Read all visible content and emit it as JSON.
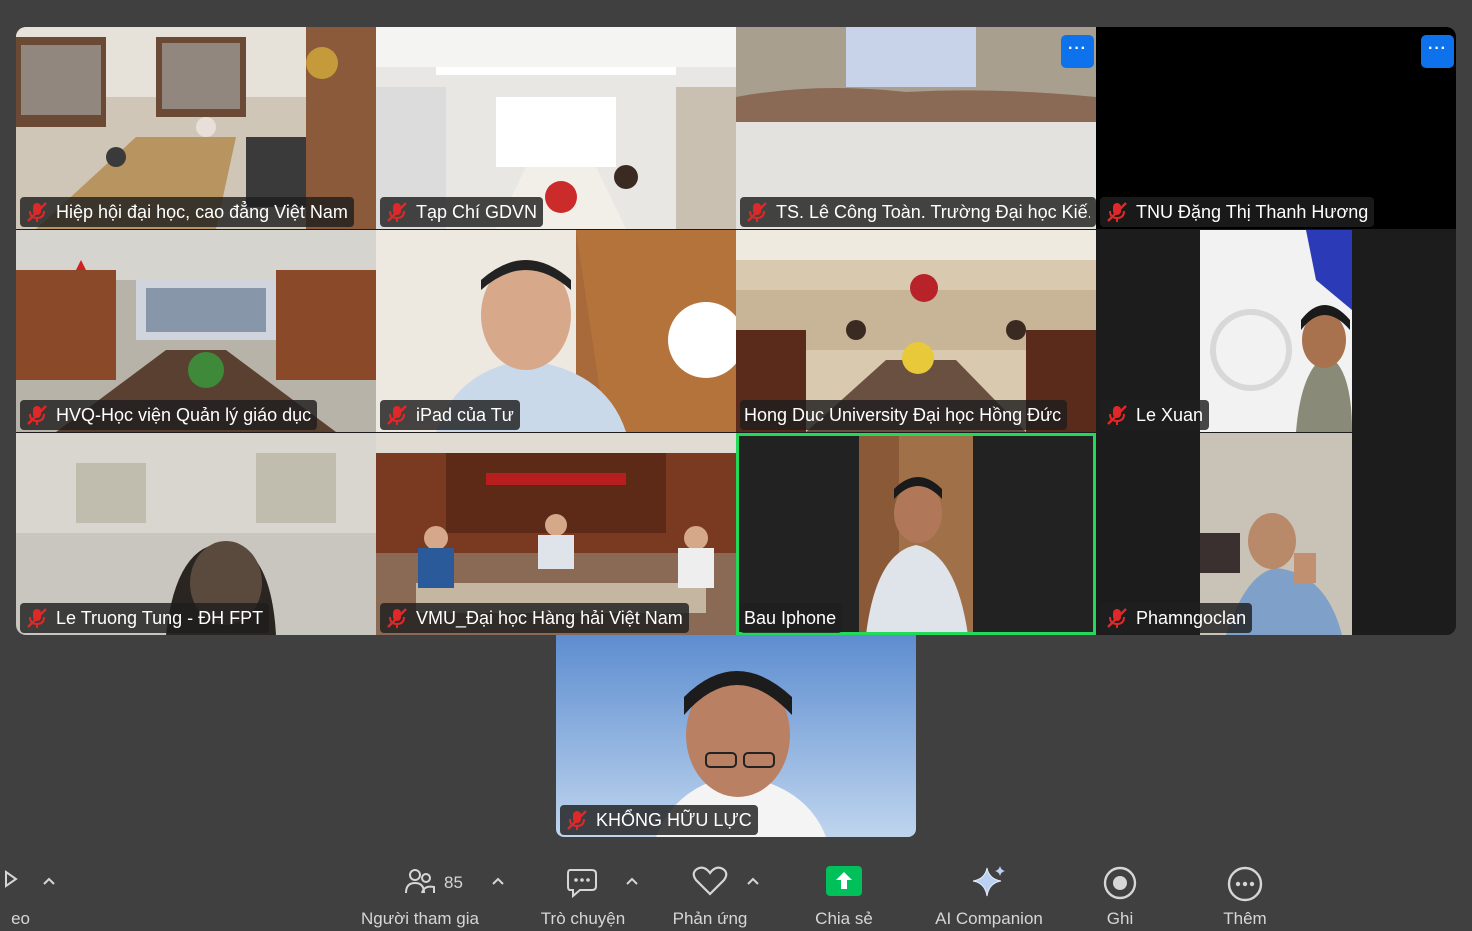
{
  "tiles": [
    {
      "name": "Hiệp hội đại học, cao đẳng Việt Nam",
      "muted": true
    },
    {
      "name": "Tạp Chí GDVN",
      "muted": true
    },
    {
      "name": "TS. Lê Công Toàn. Trường Đại học Kiế...",
      "muted": true
    },
    {
      "name": "TNU Đặng Thị Thanh Hương",
      "muted": true
    },
    {
      "name": "HVQ-Học viện Quản lý giáo dục",
      "muted": true
    },
    {
      "name": "iPad của Tư",
      "muted": true
    },
    {
      "name": "Hong Duc University Đại học Hồng Đức",
      "muted": false
    },
    {
      "name": "Le Xuan",
      "muted": true
    },
    {
      "name": "Le Truong Tung - ĐH FPT",
      "muted": true
    },
    {
      "name": "VMU_Đại học Hàng hải Việt Nam",
      "muted": true
    },
    {
      "name": "Bau Iphone",
      "muted": false,
      "active_speaker": true
    },
    {
      "name": "Phamngoclan",
      "muted": true
    }
  ],
  "self_view": {
    "name": "KHỔNG HỮU LỰC",
    "muted": true
  },
  "more_button_glyph": "···",
  "toolbar": {
    "video_label_partial": "eo",
    "participants": {
      "label": "Người tham gia",
      "count": "85"
    },
    "chat": {
      "label": "Trò chuyện"
    },
    "reactions": {
      "label": "Phản ứng"
    },
    "share": {
      "label": "Chia sẻ"
    },
    "ai": {
      "label": "AI Companion"
    },
    "record": {
      "label": "Ghi"
    },
    "more": {
      "label": "Thêm"
    }
  },
  "colors": {
    "background": "#404040",
    "muted_red": "#e02828",
    "active_green": "#23d959",
    "share_green": "#00c05a",
    "more_blue": "#0e72ed"
  }
}
